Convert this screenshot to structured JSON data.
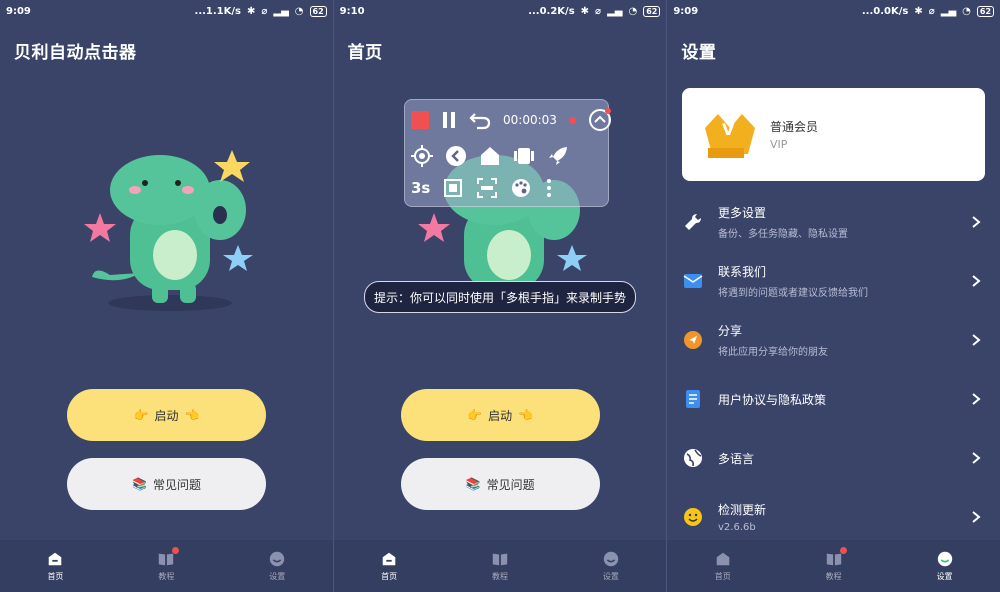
{
  "screens": [
    {
      "status": {
        "time": "9:09",
        "speed": "...1.1K/s",
        "battery": "62"
      },
      "title": "贝利自动点击器",
      "start_label": "启动",
      "faq_label": "常见问题",
      "tabs": [
        {
          "label": "首页"
        },
        {
          "label": "教程"
        },
        {
          "label": "设置"
        }
      ]
    },
    {
      "status": {
        "time": "9:10",
        "speed": "...0.2K/s",
        "battery": "62"
      },
      "title": "首页",
      "start_label": "启动",
      "faq_label": "常见问题",
      "timer": "00:00:03",
      "delay_label": "3s",
      "hint": "提示：你可以同时使用「多根手指」来录制手势",
      "tabs": [
        {
          "label": "首页"
        },
        {
          "label": "教程"
        },
        {
          "label": "设置"
        }
      ]
    },
    {
      "status": {
        "time": "9:09",
        "speed": "...0.0K/s",
        "battery": "62"
      },
      "title": "设置",
      "vip": {
        "badge": "V",
        "level": "普通会员",
        "sub": "VIP"
      },
      "settings": [
        {
          "title": "更多设置",
          "sub": "备份、多任务隐藏、隐私设置"
        },
        {
          "title": "联系我们",
          "sub": "将遇到的问题或者建议反馈给我们"
        },
        {
          "title": "分享",
          "sub": "将此应用分享给你的朋友"
        },
        {
          "title": "用户协议与隐私政策",
          "sub": ""
        },
        {
          "title": "多语言",
          "sub": ""
        },
        {
          "title": "检测更新",
          "sub": "v2.6.6b"
        }
      ],
      "tabs": [
        {
          "label": "首页"
        },
        {
          "label": "教程"
        },
        {
          "label": "设置"
        }
      ]
    }
  ],
  "colors": {
    "background": "#3a4469",
    "start_button": "#fce07a",
    "faq_button": "#efeff2",
    "badge": "#f05050"
  }
}
